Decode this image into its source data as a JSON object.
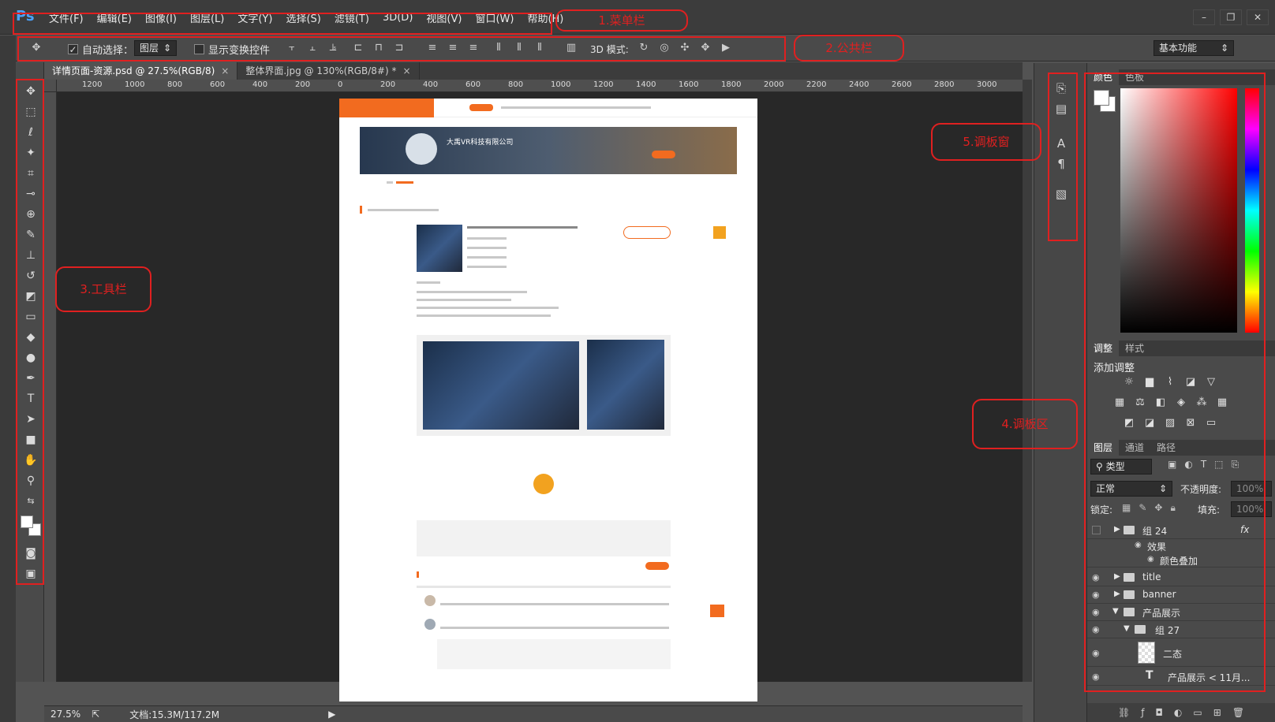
{
  "app": {
    "logo": "Ps"
  },
  "menu": {
    "items": [
      "文件(F)",
      "编辑(E)",
      "图像(I)",
      "图层(L)",
      "文字(Y)",
      "选择(S)",
      "滤镜(T)",
      "3D(D)",
      "视图(V)",
      "窗口(W)",
      "帮助(H)"
    ],
    "window_controls": [
      "–",
      "❐",
      "✕"
    ]
  },
  "options": {
    "auto_select_label": "自动选择：",
    "auto_select_target": "图层",
    "show_transform_label": "显示变换控件",
    "mode_3d_label": "3D 模式:",
    "workspace": "基本功能"
  },
  "tabs": [
    {
      "title": "详情页面-资源.psd @ 27.5%(RGB/8)",
      "close": "×"
    },
    {
      "title": "整体界面.jpg @ 130%(RGB/8#) *",
      "close": "×"
    }
  ],
  "ruler": {
    "h_labels": [
      "1200",
      "1000",
      "800",
      "600",
      "400",
      "200",
      "0",
      "200",
      "400",
      "600",
      "800",
      "1000",
      "1200",
      "1400",
      "1600",
      "1800",
      "2000",
      "2200",
      "2400",
      "2600",
      "2800",
      "3000"
    ]
  },
  "status": {
    "zoom": "27.5%",
    "doc_size": "文档:15.3M/117.2M"
  },
  "panels": {
    "color_tabs": [
      "颜色",
      "色板"
    ],
    "adjust_tabs": [
      "调整",
      "样式"
    ],
    "adjust_title": "添加调整",
    "layer_tabs": [
      "图层",
      "通道",
      "路径"
    ],
    "layer_filter": "类型",
    "blend_mode": "正常",
    "opacity_label": "不透明度:",
    "opacity_value": "100%",
    "lock_label": "锁定:",
    "fill_label": "填充:",
    "fill_value": "100%"
  },
  "layers": [
    {
      "name": "组 24",
      "fx": "fx"
    },
    {
      "name": "效果"
    },
    {
      "name": "颜色叠加"
    },
    {
      "name": "title"
    },
    {
      "name": "banner"
    },
    {
      "name": "产品展示"
    },
    {
      "name": "组 27"
    },
    {
      "name": "二态"
    },
    {
      "name": "产品展示 < 11月..."
    }
  ],
  "annotations": [
    "1.菜单栏",
    "2.公共栏",
    "3.工具栏",
    "4.调板区",
    "5.调板窗"
  ],
  "doc": {
    "company": "大禹VR科技有限公司"
  },
  "colors": {
    "accent": "#f26b1f",
    "annotation": "#e02020",
    "ps_blue": "#4aa3ff"
  }
}
